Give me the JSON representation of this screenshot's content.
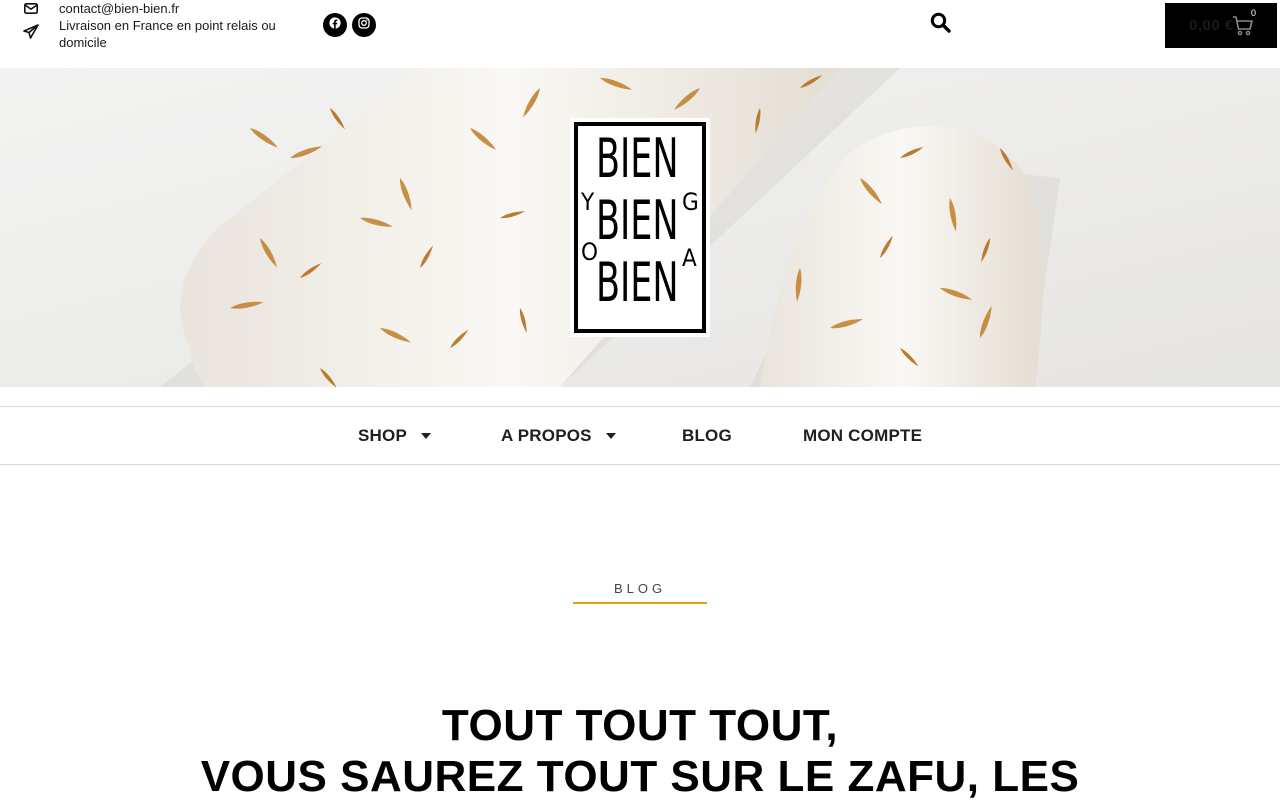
{
  "topbar": {
    "email": "contact@bien-bien.fr",
    "shipping": "Livraison en France en point relais ou domicile",
    "social": [
      {
        "name": "facebook",
        "icon": "facebook-icon"
      },
      {
        "name": "instagram",
        "icon": "instagram-icon"
      }
    ],
    "search_icon": "search-icon",
    "cart": {
      "amount": "0,00 €",
      "count": "0",
      "icon": "cart-icon"
    }
  },
  "logo": {
    "alt": "Bien Bien Bien Yoga",
    "words": [
      "BIEN",
      "BIEN",
      "BIEN"
    ],
    "side_letters": {
      "left": [
        "Y",
        "O"
      ],
      "right": [
        "G",
        "A"
      ]
    }
  },
  "nav": {
    "items": [
      {
        "label": "SHOP",
        "has_dropdown": true
      },
      {
        "label": "A PROPOS",
        "has_dropdown": true
      },
      {
        "label": "BLOG",
        "has_dropdown": false
      },
      {
        "label": "MON COMPTE",
        "has_dropdown": false
      }
    ]
  },
  "content": {
    "eyebrow": "BLOG",
    "headline_line1": "TOUT TOUT TOUT,",
    "headline_line2": "VOUS SAUREZ TOUT SUR LE ZAFU, LES"
  },
  "colors": {
    "accent": "#d6a419",
    "black": "#000000",
    "leaf": "#c58a3c"
  }
}
